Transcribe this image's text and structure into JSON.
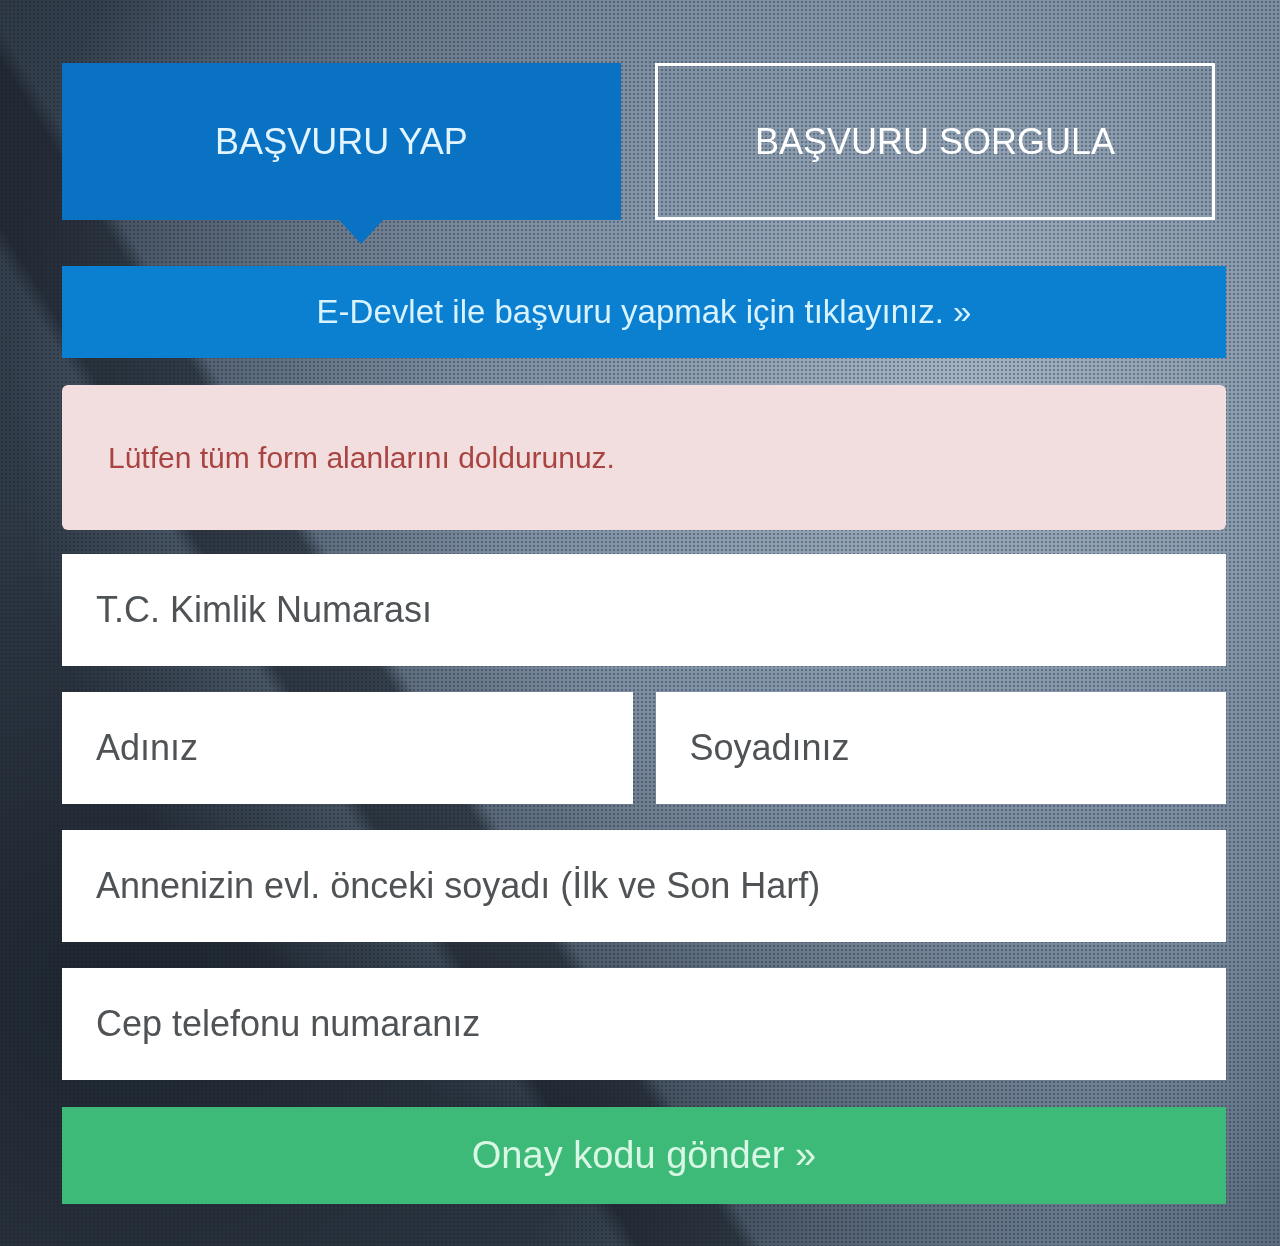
{
  "tabs": [
    {
      "label": "BAŞVURU YAP",
      "selected": true
    },
    {
      "label": "BAŞVURU SORGULA",
      "selected": false
    }
  ],
  "edevlet_link": {
    "label": "E-Devlet ile başvuru yapmak için tıklayınız. »"
  },
  "alert": {
    "text": "Lütfen tüm form alanlarını doldurunuz."
  },
  "form": {
    "rows": [
      {
        "fields": [
          {
            "placeholder": "T.C. Kimlik Numarası"
          }
        ]
      },
      {
        "fields": [
          {
            "placeholder": "Adınız"
          },
          {
            "placeholder": "Soyadınız"
          }
        ]
      },
      {
        "fields": [
          {
            "placeholder": "Annenizin evl. önceki soyadı (İlk ve Son Harf)"
          }
        ]
      },
      {
        "fields": [
          {
            "placeholder": "Cep telefonu numaranız"
          }
        ]
      }
    ]
  },
  "submit_button": {
    "label": "Onay kodu gönder »"
  }
}
